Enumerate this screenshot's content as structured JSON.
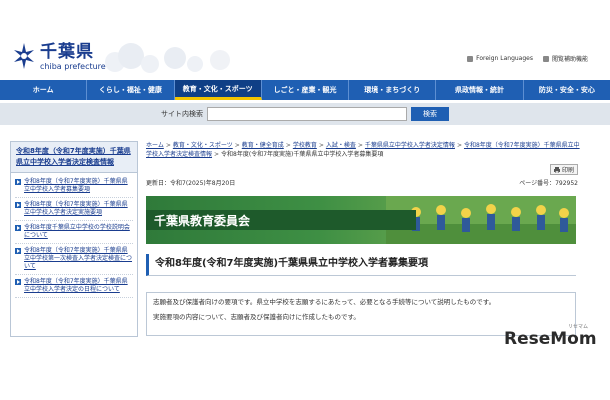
{
  "header": {
    "logo_title": "千葉県",
    "logo_sub": "chiba prefecture",
    "links": [
      {
        "label": "Foreign Languages",
        "icon": "globe-icon"
      },
      {
        "label": "閲覧補助機能",
        "icon": "accessibility-icon"
      }
    ]
  },
  "nav": {
    "items": [
      {
        "label": "ホーム"
      },
      {
        "label": "くらし・福祉・健康"
      },
      {
        "label": "教育・文化・スポーツ",
        "active": true
      },
      {
        "label": "しごと・産業・観光"
      },
      {
        "label": "環境・まちづくり"
      },
      {
        "label": "県政情報・統計"
      },
      {
        "label": "防災・安全・安心"
      }
    ]
  },
  "search": {
    "label": "サイト内検索",
    "placeholder": "",
    "value": "",
    "button_label": "検索"
  },
  "sidebar": {
    "heading": "令和8年度（令和7年度実施）千葉県県立中学校入学者決定検査情報",
    "items": [
      {
        "label": "令和8年度（令和7年度実施）千葉県県立中学校入学者募集要項"
      },
      {
        "label": "令和8年度（令和7年度実施）千葉県県立中学校入学者決定実施要項"
      },
      {
        "label": "令和8年度千葉県立中学校の学校説明会について"
      },
      {
        "label": "令和8年度（令和7年度実施）千葉県県立中学校第一次検査入学者決定検査について"
      },
      {
        "label": "令和8年度（令和7年度実施）千葉県県立中学校入学者決定の日程について"
      }
    ]
  },
  "breadcrumb": {
    "items": [
      "ホーム",
      "教育・文化・スポーツ",
      "教育・健全育成",
      "学校教育",
      "入試・検査",
      "千葉県県立中学校入学者決定情報",
      "令和8年度（令和7年度実施）千葉県県立中学校入学者決定検査情報"
    ],
    "current": "令和8年度(令和7年度実施)千葉県県立中学校入学者募集要項",
    "separator": ">"
  },
  "print_label": "印刷",
  "updated": "更新日：令和7(2025)年8月20日",
  "page_number": "ページ番号：792952",
  "banner_title": "千葉県教育委員会",
  "page_title": "令和8年度(令和7年度実施)千葉県県立中学校入学者募集要項",
  "notice": {
    "line1": "志願者及び保護者向けの要項です。県立中学校を志願するにあたって、必要となる手続等について説明したものです。",
    "line2": "実施要項の内容について、志願者及び保護者向けに作成したものです。"
  },
  "watermark": {
    "text": "ReseMom",
    "small": "リセマム"
  },
  "colors": {
    "nav": "#1f5fb3",
    "nav_active": "#0f3f86",
    "accent": "#f2c400",
    "link": "#1a3d8f",
    "banner": "#2f7a3a"
  }
}
